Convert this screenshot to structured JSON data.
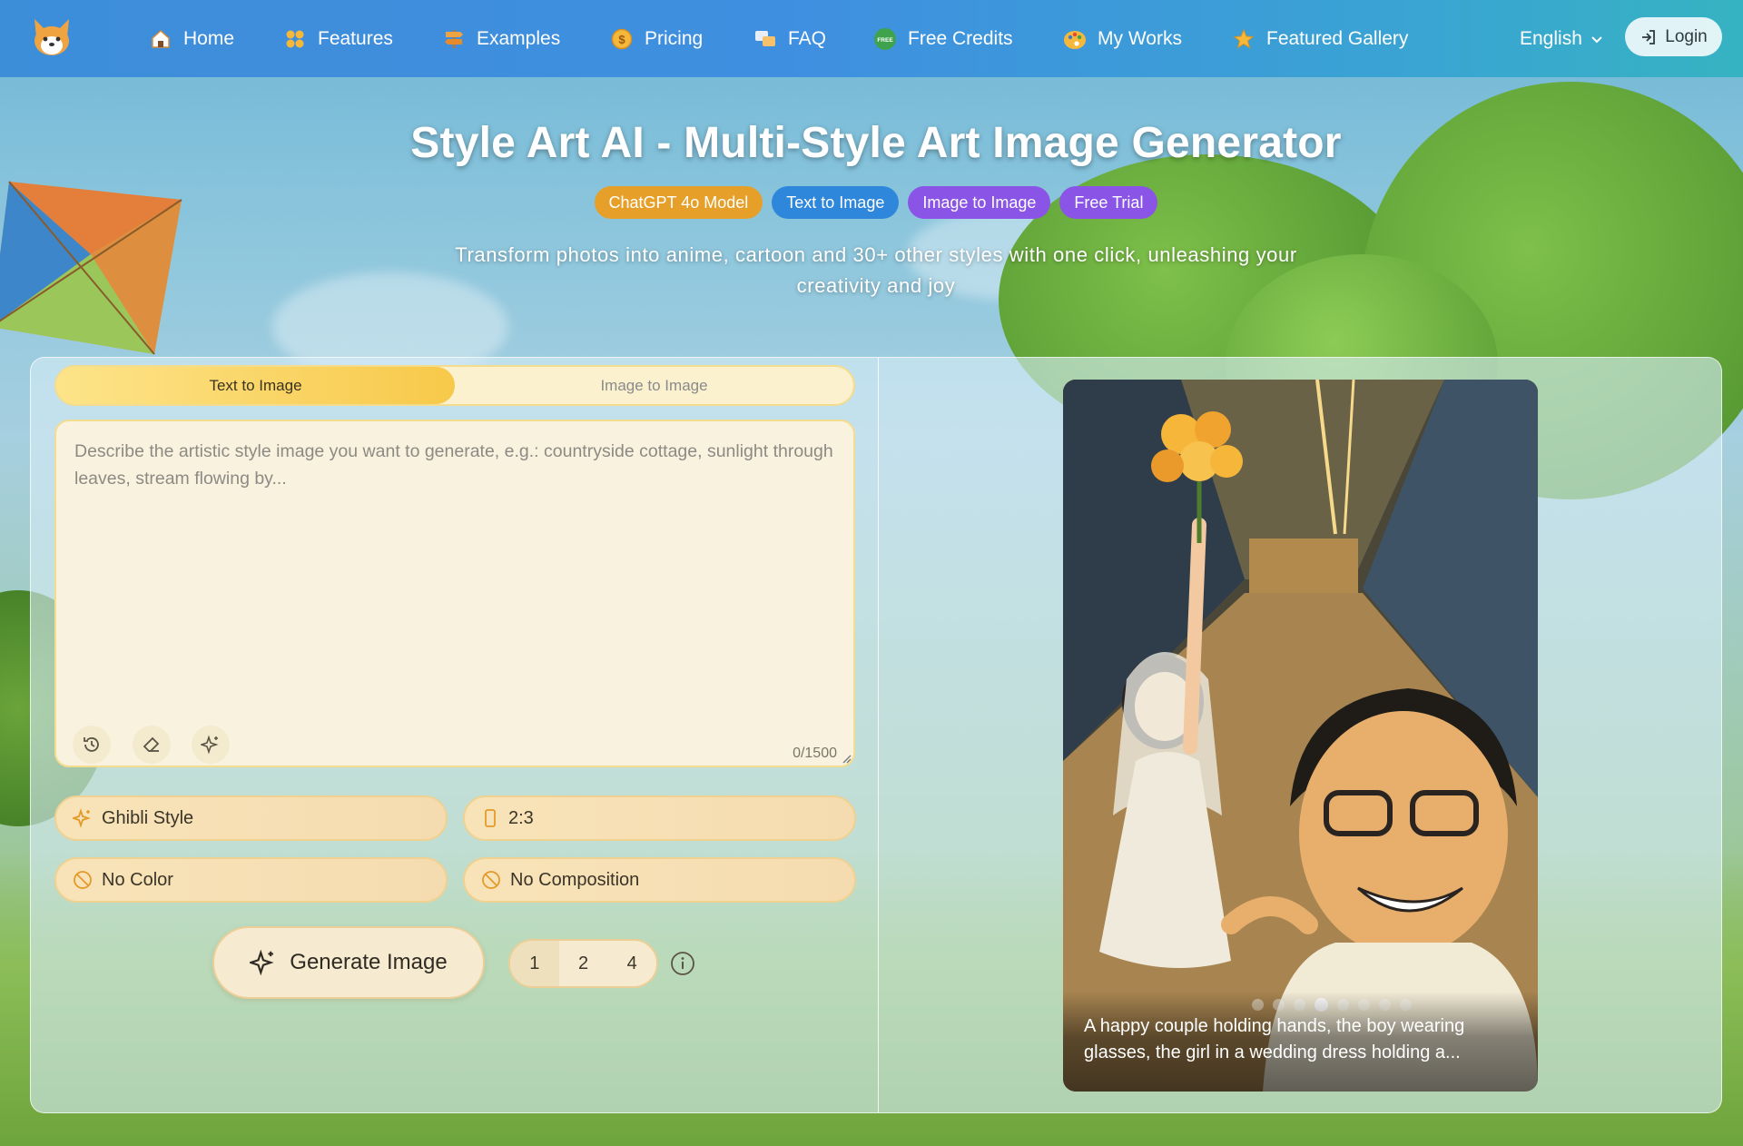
{
  "nav": {
    "logo_icon": "corgi-logo-icon",
    "items": [
      {
        "label": "Home",
        "icon": "house-icon"
      },
      {
        "label": "Features",
        "icon": "grid-dots-icon"
      },
      {
        "label": "Examples",
        "icon": "signpost-icon"
      },
      {
        "label": "Pricing",
        "icon": "coin-icon"
      },
      {
        "label": "FAQ",
        "icon": "chat-icon"
      },
      {
        "label": "Free Credits",
        "icon": "free-badge-icon"
      },
      {
        "label": "My Works",
        "icon": "palette-icon"
      },
      {
        "label": "Featured Gallery",
        "icon": "star-icon"
      }
    ],
    "language": "English",
    "login": "Login"
  },
  "hero": {
    "title": "Style Art AI - Multi-Style Art Image Generator",
    "badges": [
      "ChatGPT 4o Model",
      "Text to Image",
      "Image to Image",
      "Free Trial"
    ],
    "subtitle": "Transform photos into anime, cartoon and 30+ other styles with one click, unleashing your creativity and joy"
  },
  "generator": {
    "tabs": [
      "Text to Image",
      "Image to Image"
    ],
    "active_tab": "Text to Image",
    "prompt": {
      "placeholder": "Describe the artistic style image you want to generate, e.g.: countryside cottage, sunlight through leaves, stream flowing by...",
      "value": "",
      "counter": "0/1500",
      "tools": [
        "history-icon",
        "eraser-icon",
        "sparkle-icon"
      ]
    },
    "options": {
      "style": "Ghibli Style",
      "ratio": "2:3",
      "color": "No Color",
      "composition": "No Composition"
    },
    "generate_label": "Generate Image",
    "count_options": [
      "1",
      "2",
      "4"
    ],
    "selected_count": "1"
  },
  "showcase": {
    "caption": "A happy couple holding hands, the boy wearing glasses, the girl in a wedding dress holding a...",
    "slide_count": 8,
    "active_slide": 4
  },
  "colors": {
    "nav_gradient_start": "#3d8ed9",
    "nav_gradient_end": "#36b3c2",
    "badge_orange": "#e6a02a",
    "badge_blue": "#2f87db",
    "badge_purple": "#8a55e6",
    "tab_active": "#f7c94a"
  }
}
